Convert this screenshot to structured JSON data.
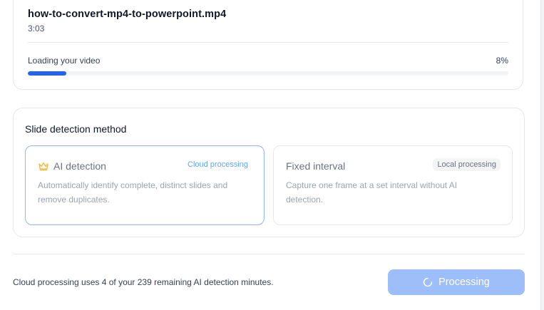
{
  "video": {
    "file_name": "how-to-convert-mp4-to-powerpoint.mp4",
    "duration": "3:03",
    "loading_label": "Loading your video",
    "progress_text": "8%",
    "progress_value": 8
  },
  "method": {
    "title": "Slide detection method",
    "options": [
      {
        "title": "AI detection",
        "tag": "Cloud processing",
        "description": "Automatically identify complete, distinct slides and remove duplicates.",
        "icon": "crown-icon",
        "selected": true
      },
      {
        "title": "Fixed interval",
        "tag": "Local processing",
        "description": "Capture one frame at a set interval without AI detection.",
        "selected": false
      }
    ]
  },
  "footer": {
    "note": "Cloud processing uses 4 of your 239 remaining AI detection minutes.",
    "button_label": "Processing",
    "button_icon": "spinner-icon"
  },
  "colors": {
    "accent": "#2563eb",
    "selected_border": "#93b4f5",
    "button_disabled": "#9dbef8",
    "crown": "#f5b942"
  }
}
